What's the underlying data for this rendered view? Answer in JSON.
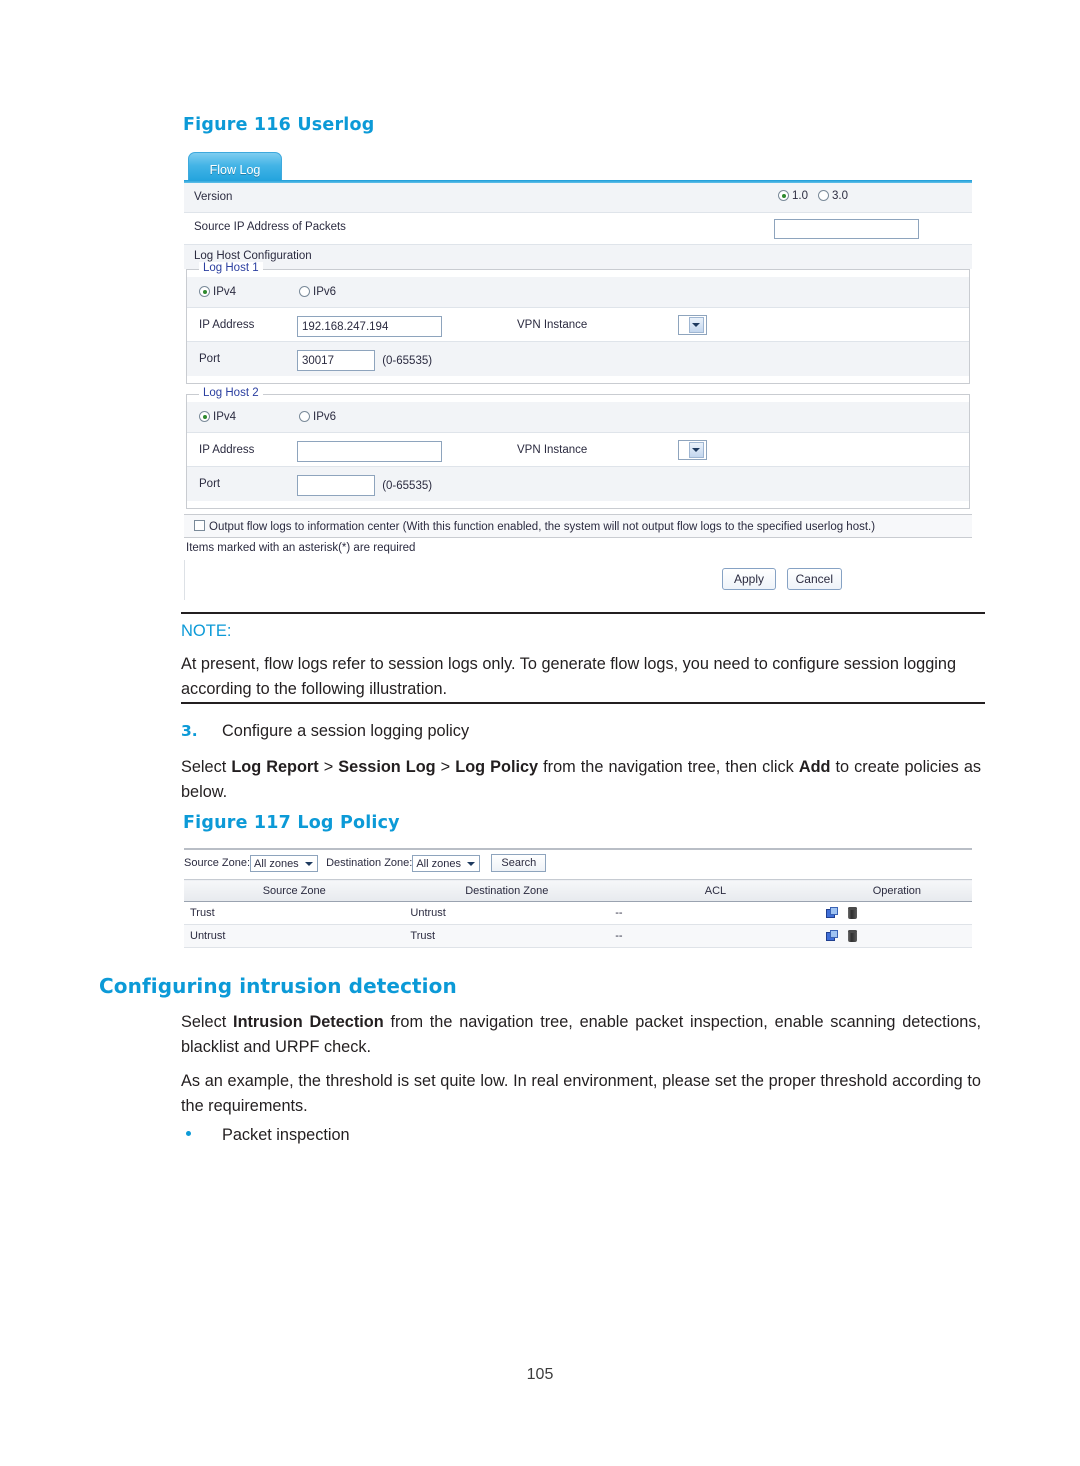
{
  "page": {
    "number": "105"
  },
  "figure116": {
    "caption": "Figure 116 Userlog",
    "tab_label": "Flow Log",
    "version": {
      "label": "Version",
      "option_1": "1.0",
      "option_2": "3.0",
      "selected": "1.0"
    },
    "source_ip": {
      "label": "Source IP Address of Packets",
      "value": ""
    },
    "log_host_configuration_label": "Log Host Configuration",
    "log_hosts": [
      {
        "legend": "Log Host 1",
        "ipv4_label": "IPv4",
        "ipv6_label": "IPv6",
        "ip_version_selected": "IPv4",
        "ip_address_label": "IP Address",
        "ip_address_value": "192.168.247.194",
        "vpn_instance_label": "VPN Instance",
        "vpn_instance_value": "",
        "port_label": "Port",
        "port_value": "30017",
        "port_range": "(0-65535)"
      },
      {
        "legend": "Log Host 2",
        "ipv4_label": "IPv4",
        "ipv6_label": "IPv6",
        "ip_version_selected": "IPv4",
        "ip_address_label": "IP Address",
        "ip_address_value": "",
        "vpn_instance_label": "VPN Instance",
        "vpn_instance_value": "",
        "port_label": "Port",
        "port_value": "",
        "port_range": "(0-65535)"
      }
    ],
    "output_checkbox": {
      "label": "Output flow logs to information center (With this function enabled, the system will not output flow logs to the specified userlog host.)",
      "checked": false
    },
    "required_note": "Items marked with an asterisk(*) are required",
    "apply_label": "Apply",
    "cancel_label": "Cancel"
  },
  "note": {
    "label": "NOTE:",
    "text": "At present, flow logs refer to session logs only. To generate flow logs, you need to configure session logging according to the following illustration."
  },
  "step3": {
    "number": "3.",
    "title": "Configure a session logging policy",
    "paragraph_part1": "Select ",
    "bold1": "Log Report",
    "sep1": " > ",
    "bold2": "Session Log",
    "sep2": " > ",
    "bold3": "Log Policy",
    "paragraph_part2": " from the navigation tree, then click ",
    "bold4": "Add",
    "paragraph_part3": " to create policies as below."
  },
  "figure117": {
    "caption": "Figure 117 Log Policy",
    "toolbar": {
      "source_zone_label": "Source Zone:",
      "source_zone_value": "All zones",
      "destination_zone_label": "Destination Zone:",
      "destination_zone_value": "All zones",
      "search_label": "Search"
    },
    "table": {
      "columns": [
        "Source Zone",
        "Destination Zone",
        "ACL",
        "Operation"
      ],
      "rows": [
        {
          "source_zone": "Trust",
          "destination_zone": "Untrust",
          "acl": "--"
        },
        {
          "source_zone": "Untrust",
          "destination_zone": "Trust",
          "acl": "--"
        }
      ]
    }
  },
  "intrusion": {
    "heading": "Configuring intrusion detection",
    "para1_part1": "Select ",
    "para1_bold": "Intrusion Detection",
    "para1_part2": " from the navigation tree, enable packet inspection, enable scanning detections, blacklist and URPF check.",
    "para2": "As an example, the threshold is set quite low. In real environment, please set the proper threshold according to the requirements.",
    "bullet1": "Packet inspection"
  }
}
